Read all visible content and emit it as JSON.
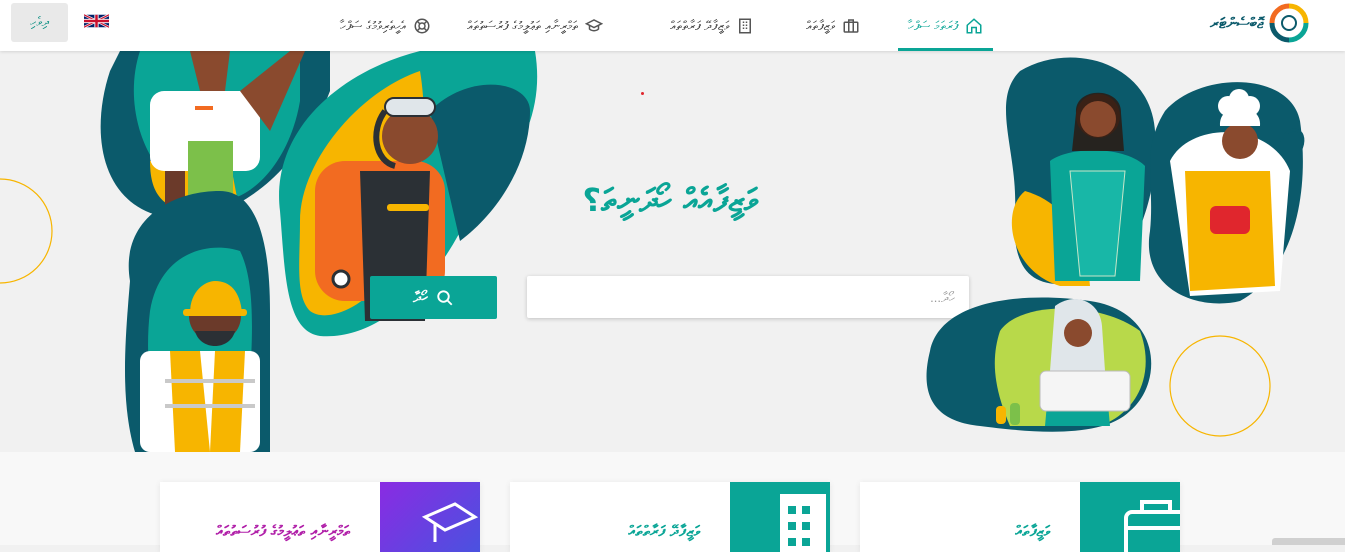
{
  "header": {
    "lang_button_label": "ދިވެހި",
    "logo_text": "ޖޮބްސެންޓަރ",
    "nav": [
      {
        "label": "ފުރަތަމަ ސަފްހާ",
        "icon": "home-icon",
        "active": true
      },
      {
        "label": "ވަޒީފާތައް",
        "icon": "briefcase-icon",
        "active": false
      },
      {
        "label": "ވަޒީފާދޭ ފަރާތްތައް",
        "icon": "building-icon",
        "active": false
      },
      {
        "label": "ތަމްރީނާއި ތަޢުލީމުގެ ފުރުސަތުތައް",
        "icon": "graduation-cap-icon",
        "active": false
      },
      {
        "label": "އެހީތެރިވުމުގެ ސަފްހާ",
        "icon": "lifebuoy-icon",
        "active": false
      }
    ]
  },
  "hero": {
    "title": "ވަޒީފާއެއް ހޯދަނީތަ؟",
    "search_placeholder": "ހޯދާ...",
    "search_button_label": "ހޯދާ"
  },
  "cards": [
    {
      "label": "ތަމްރީނާއި ތަޢުލީމުގެ ފުރުސަތުތައް",
      "icon": "graduation-cap-icon",
      "label_color": "#b01ea8"
    },
    {
      "label": "ވަޒީފާދޭ ފަރާތްތައް",
      "icon": "building-icon",
      "label_color": "#0aa596"
    },
    {
      "label": "ވަޒީފާތައް",
      "icon": "briefcase-icon",
      "label_color": "#0aa596"
    }
  ],
  "colors": {
    "accent": "#0aa596",
    "teal_dark": "#0b5a6b",
    "purple": "#8a2be2",
    "yellow": "#f7b500",
    "orange": "#f26b21"
  }
}
